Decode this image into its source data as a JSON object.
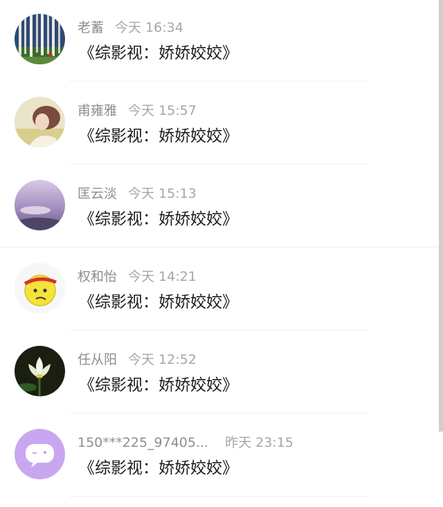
{
  "conversations": [
    {
      "name": "老蓄",
      "time": "今天 16:34",
      "message": "《综影视：娇娇姣姣》",
      "avatar": "birch-forest-avatar"
    },
    {
      "name": "甫雍雅",
      "time": "今天 15:57",
      "message": "《综影视：娇娇姣姣》",
      "avatar": "girl-portrait-avatar"
    },
    {
      "name": "匡云淡",
      "time": "今天 15:13",
      "message": "《综影视：娇娇姣姣》",
      "avatar": "misty-water-avatar"
    },
    {
      "name": "权和怡",
      "time": "今天 14:21",
      "message": "《综影视：娇娇姣姣》",
      "avatar": "headband-emoji-avatar"
    },
    {
      "name": "任从阳",
      "time": "今天 12:52",
      "message": "《综影视：娇娇姣姣》",
      "avatar": "lotus-flower-avatar"
    },
    {
      "name": "150***225_97405...",
      "time": "昨天 23:15",
      "message": "《综影视：娇娇姣姣》",
      "avatar": "chat-bubble-avatar"
    }
  ],
  "colors": {
    "name_text": "#8e8e8e",
    "time_text": "#a6a6a6",
    "message_text": "#1c1c1c",
    "default_avatar_bg": "#c9a7f0"
  }
}
